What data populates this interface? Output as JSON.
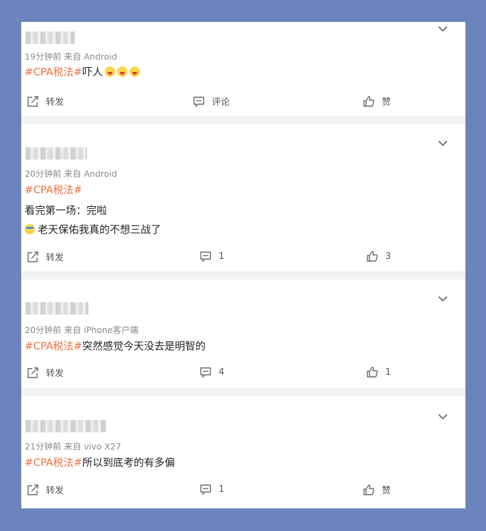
{
  "posts": [
    {
      "meta": "19分钟前  来自 Android",
      "lines": [
        {
          "tag": "#CPA税法#",
          "text": "吓人"
        }
      ],
      "emoji_count": 3,
      "repost_label": "转发",
      "comment_label": "评论",
      "like_label": "赞"
    },
    {
      "meta": "20分钟前  来自 Android",
      "lines": [
        {
          "tag": "#CPA税法#",
          "text": ""
        },
        {
          "tag": "",
          "text": "看完第一场：完啦"
        },
        {
          "tag": "",
          "text": "老天保佑我真的不想三战了"
        }
      ],
      "repost_label": "转发",
      "comment_label": "1",
      "like_label": "3"
    },
    {
      "meta": "20分钟前  来自 iPhone客户端",
      "lines": [
        {
          "tag": "#CPA税法#",
          "text": "突然感觉今天没去是明智的"
        }
      ],
      "repost_label": "转发",
      "comment_label": "4",
      "like_label": "1"
    },
    {
      "meta": "21分钟前  来自 vivo X27",
      "lines": [
        {
          "tag": "#CPA税法#",
          "text": "所以到底考的有多偏"
        }
      ],
      "repost_label": "转发",
      "comment_label": "1",
      "like_label": "赞"
    }
  ],
  "colors": {
    "background": "#6b84bd",
    "hashtag": "#eb7340",
    "separator": "#f2f2f2"
  },
  "icons": [
    "repost-icon",
    "comment-icon",
    "like-icon",
    "chevron-down-icon"
  ]
}
